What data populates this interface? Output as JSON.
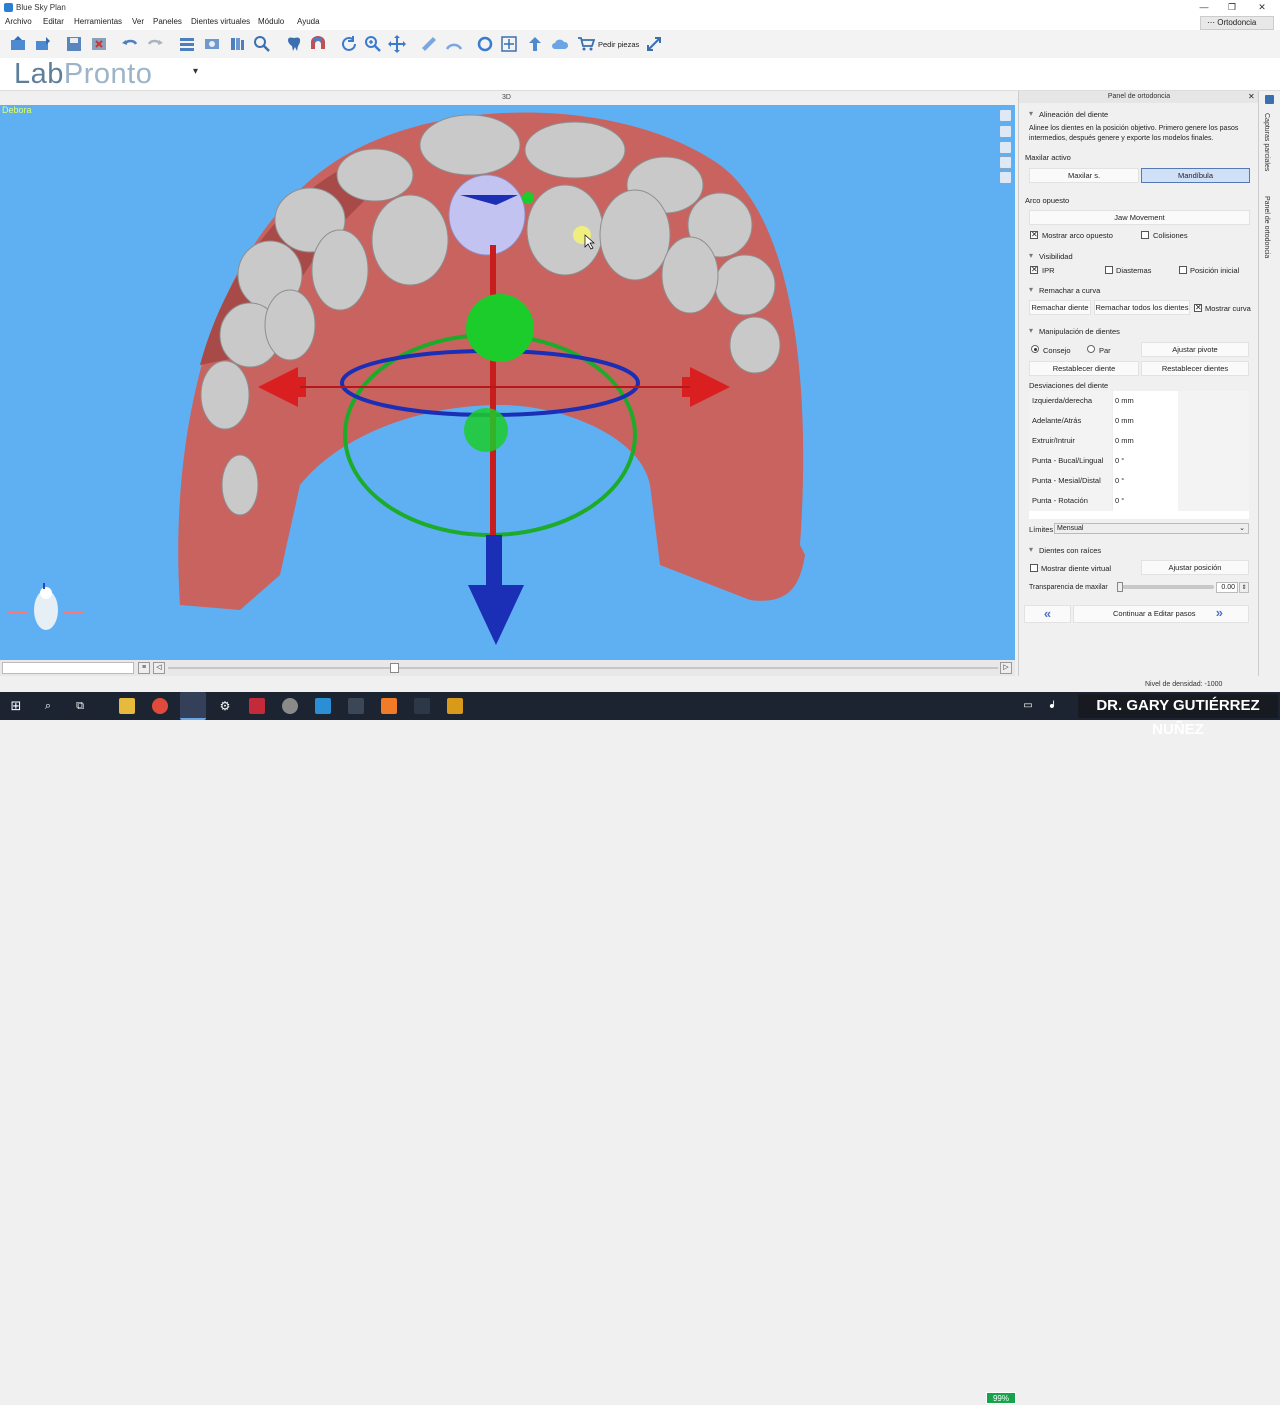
{
  "window": {
    "title": "Blue Sky Plan",
    "badge": "Ortodoncia"
  },
  "menu": [
    "Archivo",
    "Editar",
    "Herramientas",
    "Ver",
    "Paneles",
    "Dientes virtuales",
    "Módulo",
    "Ayuda"
  ],
  "toolbar": {
    "order_label": "Pedir piezas"
  },
  "brand": {
    "lab": "Lab",
    "pronto": "Pronto"
  },
  "viewport": {
    "label": "3D",
    "patient": "Debora"
  },
  "panel": {
    "title": "Panel de ortodoncia",
    "align": {
      "section": "Alineación del diente",
      "description": "Alinee los dientes en la posición objetivo. Primero genere los pasos intermedios, después genere y exporte los modelos finales.",
      "active_label": "Maxilar activo",
      "maxilar": "Maxilar s.",
      "mandibula": "Mandíbula"
    },
    "opposite": {
      "section": "Arco opuesto",
      "jaw_movement": "Jaw Movement",
      "show_opposite": "Mostrar arco opuesto",
      "collisions": "Colisiones"
    },
    "visibility": {
      "section": "Visibilidad",
      "ipr": "IPR",
      "diastemas": "Diastemas",
      "initial": "Posición inicial"
    },
    "curve": {
      "section": "Remachar a curva",
      "tooth": "Remachar diente",
      "all": "Remachar todos los dientes",
      "show": "Mostrar curva"
    },
    "manip": {
      "section": "Manipulación de dientes",
      "consejo": "Consejo",
      "par": "Par",
      "pivot": "Ajustar pivote",
      "reset_tooth": "Restablecer diente",
      "reset_teeth": "Restablecer dientes",
      "deviations": "Desviaciones del diente",
      "rows": [
        {
          "label": "Izquierda/derecha",
          "value": "0 mm"
        },
        {
          "label": "Adelante/Atrás",
          "value": "0 mm"
        },
        {
          "label": "Extruir/Intruir",
          "value": "0 mm"
        },
        {
          "label": "Punta - Bucal/Lingual",
          "value": "0 °"
        },
        {
          "label": "Punta - Mesial/Distal",
          "value": "0 °"
        },
        {
          "label": "Punta - Rotación",
          "value": "0 °"
        }
      ],
      "limits_label": "Límites",
      "limits_value": "Mensual"
    },
    "roots": {
      "section": "Dientes con raíces",
      "virtual": "Mostrar diente virtual",
      "adjust": "Ajustar posición",
      "transparency_label": "Transparencia de maxilar",
      "transparency_value": "0.00",
      "continue": "Continuar a Editar pasos"
    }
  },
  "sidetabs": [
    "Capturas parciales",
    "Panel de ortodoncia"
  ],
  "status": {
    "density": "Nivel de densidad: -1000"
  },
  "taskbar": {
    "battery": "99%"
  },
  "watermark": "DR. GARY GUTIÉRREZ NUÑEZ",
  "colors": {
    "viewport_bg": "#5fb0f3",
    "gum": "#c9635f",
    "tooth": "#c8c8c8",
    "accent": "#5578b8"
  }
}
